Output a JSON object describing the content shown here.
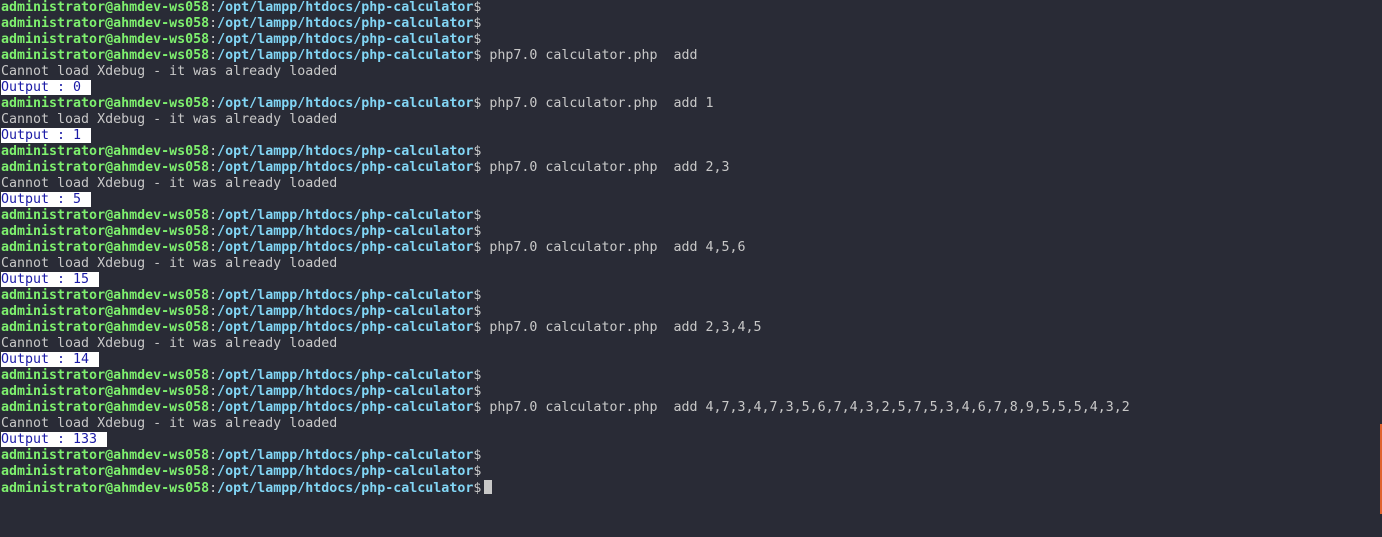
{
  "prompt": {
    "user": "administrator@ahmdev-ws058",
    "colon": ":",
    "path": "/opt/lampp/htdocs/php-calculator",
    "dollar": "$"
  },
  "lines": [
    {
      "type": "prompt",
      "cmd": ""
    },
    {
      "type": "prompt",
      "cmd": ""
    },
    {
      "type": "prompt",
      "cmd": ""
    },
    {
      "type": "prompt",
      "cmd": " php7.0 calculator.php  add"
    },
    {
      "type": "text",
      "text": "Cannot load Xdebug - it was already loaded"
    },
    {
      "type": "output",
      "text": "Output : 0"
    },
    {
      "type": "prompt",
      "cmd": " php7.0 calculator.php  add 1"
    },
    {
      "type": "text",
      "text": "Cannot load Xdebug - it was already loaded"
    },
    {
      "type": "output",
      "text": "Output : 1"
    },
    {
      "type": "prompt",
      "cmd": ""
    },
    {
      "type": "prompt",
      "cmd": " php7.0 calculator.php  add 2,3"
    },
    {
      "type": "text",
      "text": "Cannot load Xdebug - it was already loaded"
    },
    {
      "type": "output",
      "text": "Output : 5"
    },
    {
      "type": "prompt",
      "cmd": ""
    },
    {
      "type": "prompt",
      "cmd": ""
    },
    {
      "type": "prompt",
      "cmd": " php7.0 calculator.php  add 4,5,6"
    },
    {
      "type": "text",
      "text": "Cannot load Xdebug - it was already loaded"
    },
    {
      "type": "output",
      "text": "Output : 15"
    },
    {
      "type": "prompt",
      "cmd": ""
    },
    {
      "type": "prompt",
      "cmd": ""
    },
    {
      "type": "prompt",
      "cmd": " php7.0 calculator.php  add 2,3,4,5"
    },
    {
      "type": "text",
      "text": "Cannot load Xdebug - it was already loaded"
    },
    {
      "type": "output",
      "text": "Output : 14"
    },
    {
      "type": "prompt",
      "cmd": ""
    },
    {
      "type": "prompt",
      "cmd": ""
    },
    {
      "type": "prompt",
      "cmd": " php7.0 calculator.php  add 4,7,3,4,7,3,5,6,7,4,3,2,5,7,5,3,4,6,7,8,9,5,5,5,4,3,2"
    },
    {
      "type": "text",
      "text": "Cannot load Xdebug - it was already loaded"
    },
    {
      "type": "output",
      "text": "Output : 133"
    },
    {
      "type": "prompt",
      "cmd": ""
    },
    {
      "type": "prompt",
      "cmd": ""
    },
    {
      "type": "prompt",
      "cmd": "",
      "cursor": true
    }
  ],
  "colors": {
    "background": "#292b36",
    "user": "#7ef06e",
    "path": "#82d6f5",
    "text": "#c8c8c8",
    "output_bg": "#ffffff",
    "output_fg": "#1a1aa6",
    "edge_accent": "#e0622e"
  }
}
